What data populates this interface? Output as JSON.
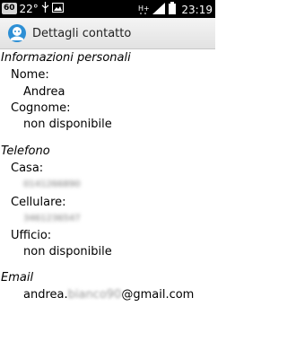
{
  "status_bar": {
    "badge": "60",
    "temperature": "22°",
    "time": "23:19",
    "icons": [
      "usb-icon",
      "picture-icon",
      "hplus-icon",
      "signal-icon",
      "battery-icon"
    ]
  },
  "action_bar": {
    "title": "Dettagli contatto",
    "icon": "contact-app-icon"
  },
  "personal": {
    "section_title": "Informazioni personali",
    "nome_label": "Nome:",
    "nome_value": "Andrea",
    "cognome_label": "Cognome:",
    "cognome_value": "non disponibile"
  },
  "phone": {
    "section_title": "Telefono",
    "casa_label": "Casa:",
    "casa_value": "0141266890",
    "cellulare_label": "Cellulare:",
    "cellulare_value": "3461236547",
    "ufficio_label": "Ufficio:",
    "ufficio_value": "non disponibile"
  },
  "email": {
    "section_title": "Email",
    "prefix": "andrea.",
    "hidden": "bianco90",
    "suffix": "@gmail.com"
  },
  "colors": {
    "status_bar_bg": "#000000",
    "action_bar_bg": "#e8e8e8",
    "accent_blue": "#2d8fd5"
  }
}
